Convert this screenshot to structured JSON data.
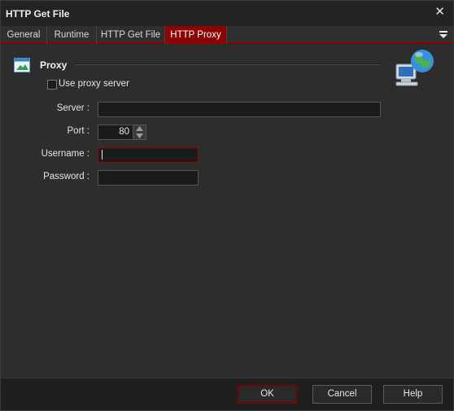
{
  "window": {
    "title": "HTTP Get File",
    "close_symbol": "✕"
  },
  "tabs": [
    {
      "label": "General"
    },
    {
      "label": "Runtime"
    },
    {
      "label": "HTTP Get File"
    },
    {
      "label": "HTTP Proxy",
      "active": true
    }
  ],
  "tab_menu_icon": "dropdown-menu-icon",
  "section": {
    "title": "Proxy",
    "icon": "panel-icon",
    "decor_icon": "network-globe-icon"
  },
  "use_proxy": {
    "label": "Use proxy server",
    "checked": false
  },
  "fields": {
    "server": {
      "label": "Server :",
      "value": ""
    },
    "port": {
      "label": "Port :",
      "value": "80"
    },
    "username": {
      "label": "Username :",
      "value": ""
    },
    "password": {
      "label": "Password :",
      "value": ""
    }
  },
  "buttons": {
    "ok": "OK",
    "cancel": "Cancel",
    "help": "Help"
  },
  "colors": {
    "accent": "#8b0000",
    "background": "#2d2d2d",
    "input_bg": "#1b1b1b"
  }
}
